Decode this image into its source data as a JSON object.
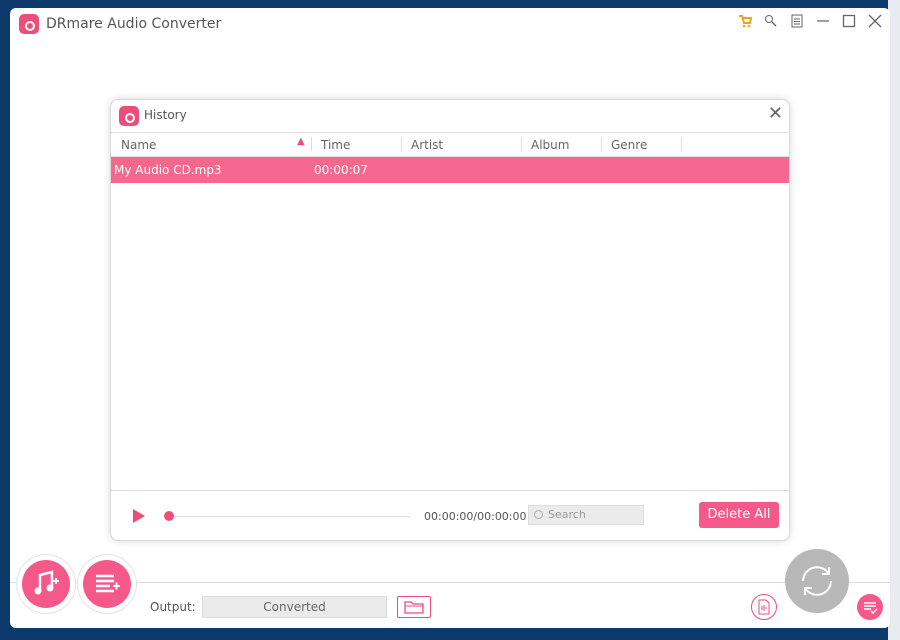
{
  "app": {
    "title": "DRmare Audio Converter",
    "accent": "#ee4d7a"
  },
  "history": {
    "title": "History",
    "columns": [
      "Name",
      "Time",
      "Artist",
      "Album",
      "Genre"
    ],
    "sort_column": "Name",
    "rows": [
      {
        "name": "My Audio CD.mp3",
        "time": "00:00:07",
        "artist": "",
        "album": "",
        "genre": ""
      }
    ],
    "player_time": "00:00:00/00:00:00",
    "search_placeholder": "Search",
    "delete_all": "Delete All"
  },
  "bottom": {
    "output_label": "Output:",
    "output_value": "Converted"
  }
}
